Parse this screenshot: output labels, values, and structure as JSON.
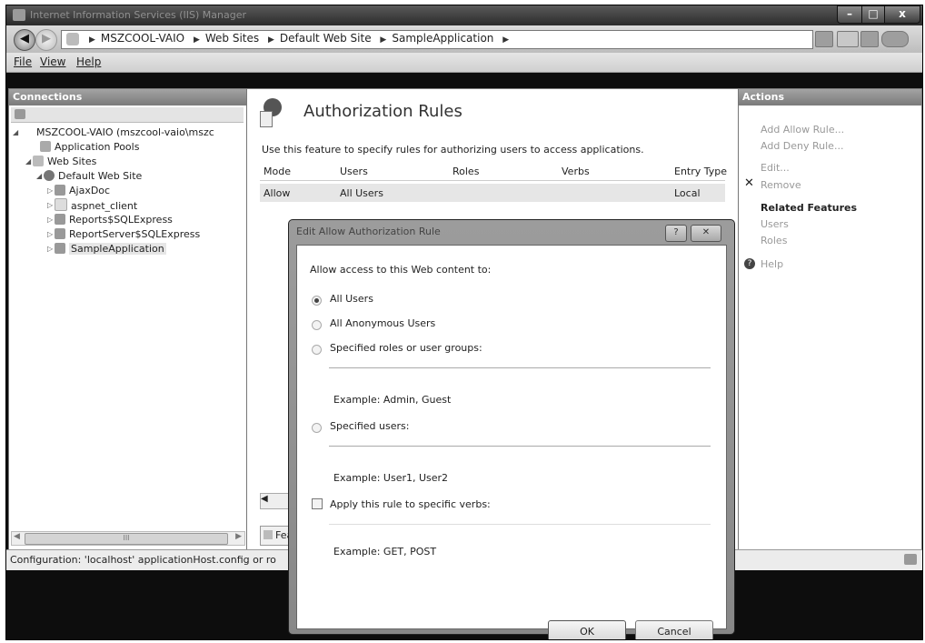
{
  "window": {
    "title": "Internet Information Services (IIS) Manager"
  },
  "navbar": {
    "crumbs": [
      "MSZCOOL-VAIO",
      "Web Sites",
      "Default Web Site",
      "SampleApplication"
    ]
  },
  "menu": [
    "File",
    "View",
    "Help"
  ],
  "connections": {
    "title": "Connections",
    "tree": [
      "MSZCOOL-VAIO (mszcool-vaio\\mszc",
      "Application Pools",
      "Web Sites",
      "Default Web Site",
      "AjaxDoc",
      "aspnet_client",
      "Reports$SQLExpress",
      "ReportServer$SQLExpress",
      "SampleApplication"
    ],
    "hscroll_label": "III"
  },
  "feature": {
    "title": "Authorization Rules",
    "description": "Use this feature to specify rules for authorizing users to access applications.",
    "columns": [
      "Mode",
      "Users",
      "Roles",
      "Verbs",
      "Entry Type"
    ],
    "rows": [
      {
        "mode": "Allow",
        "users": "All Users",
        "roles": "",
        "verbs": "",
        "entry": "Local"
      }
    ],
    "view_tab": "Fea"
  },
  "actions": {
    "title": "Actions",
    "add_allow": "Add Allow Rule...",
    "add_deny": "Add Deny Rule...",
    "edit": "Edit...",
    "remove": "Remove",
    "related": "Related Features",
    "users": "Users",
    "roles": "Roles",
    "help": "Help"
  },
  "status": {
    "text": "Configuration: 'localhost' applicationHost.config or ro"
  },
  "dialog": {
    "title": "Edit Allow Authorization Rule",
    "help_btn": "?",
    "close_btn": "✕",
    "prompt": "Allow access to this Web content to:",
    "opt_all_users": "All Users",
    "opt_anon": "All Anonymous Users",
    "opt_roles": "Specified roles or user groups:",
    "roles_example": "Example: Admin, Guest",
    "opt_users": "Specified users:",
    "users_example": "Example: User1, User2",
    "verbs_check": "Apply this rule to specific verbs:",
    "verbs_example": "Example: GET, POST",
    "ok": "OK",
    "cancel": "Cancel",
    "selected_option": "All Users"
  }
}
